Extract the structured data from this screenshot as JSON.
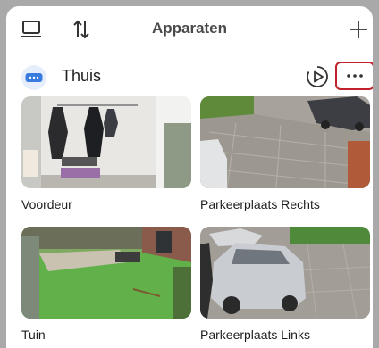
{
  "header": {
    "title": "Apparaten",
    "icons": [
      "device-list-icon",
      "sort-icon",
      "add-icon"
    ]
  },
  "section": {
    "name": "Thuis",
    "icons": [
      "hub-icon",
      "playback-icon",
      "more-icon"
    ]
  },
  "devices": [
    {
      "label": "Voordeur"
    },
    {
      "label": "Parkeerplaats Rechts"
    },
    {
      "label": "Tuin"
    },
    {
      "label": "Parkeerplaats Links"
    }
  ],
  "colors": {
    "accent_highlight": "#c0202a",
    "hub_blue": "#3a7be0",
    "background": "#a9a9a9"
  }
}
